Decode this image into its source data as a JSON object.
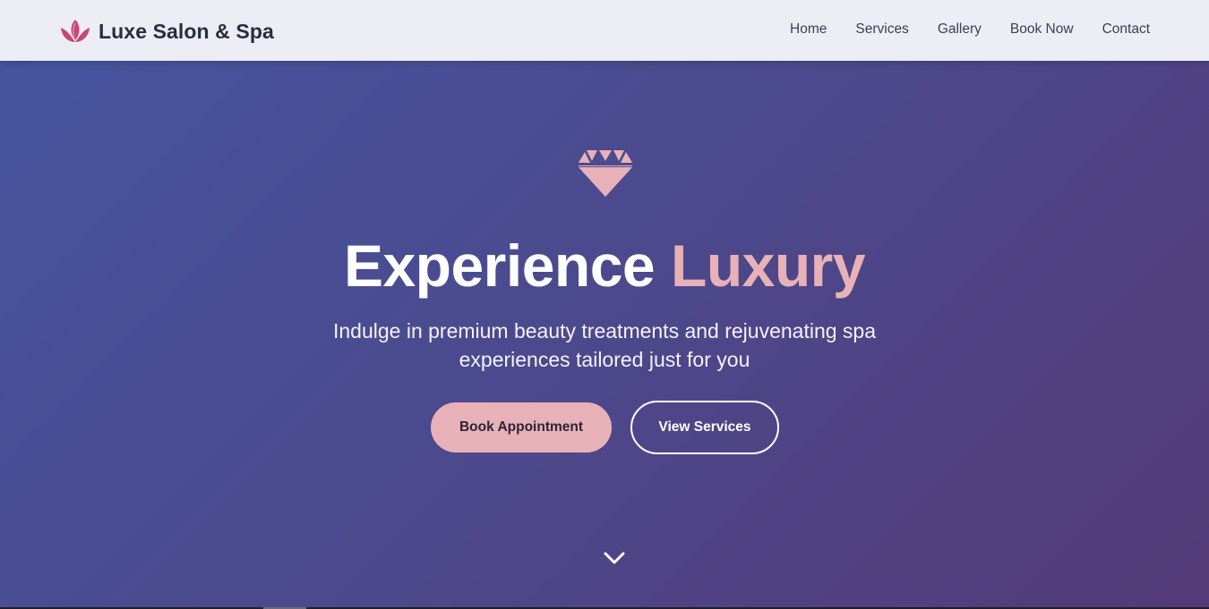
{
  "header": {
    "brand_name": "Luxe Salon & Spa",
    "brand_icon": "lotus-icon",
    "nav": [
      {
        "label": "Home"
      },
      {
        "label": "Services"
      },
      {
        "label": "Gallery"
      },
      {
        "label": "Book Now"
      },
      {
        "label": "Contact"
      }
    ]
  },
  "hero": {
    "icon": "diamond-icon",
    "headline_main": "Experience",
    "headline_accent": "Luxury",
    "subtitle": "Indulge in premium beauty treatments and rejuvenating spa experiences tailored just for you",
    "primary_button": "Book Appointment",
    "secondary_button": "View Services",
    "scroll_icon": "chevron-down-icon"
  },
  "colors": {
    "accent_pink": "#e8b1b7",
    "brand_icon_pink": "#c94672",
    "header_bg": "#ecedf5",
    "hero_gradient_start": "#44559e",
    "hero_gradient_end": "#533a78",
    "text_dark": "#2a2d3e"
  }
}
